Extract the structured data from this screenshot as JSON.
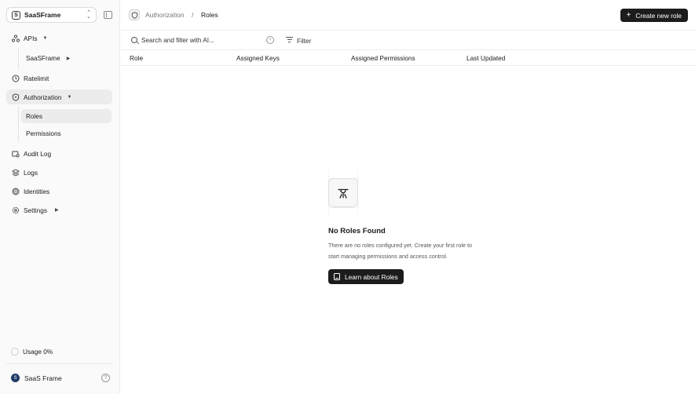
{
  "workspace": {
    "name": "SaaSFrame",
    "logo_letter": "S"
  },
  "sidebar": {
    "apis_label": "APIs",
    "apis_sub": "SaaSFrame",
    "ratelimit_label": "Ratelimit",
    "authorization_label": "Authorization",
    "roles_label": "Roles",
    "permissions_label": "Permissions",
    "audit_label": "Audit Log",
    "logs_label": "Logs",
    "identities_label": "Identities",
    "settings_label": "Settings",
    "usage_label": "Usage 0%",
    "user_name": "SaaS Frame",
    "user_initial": "S"
  },
  "header": {
    "breadcrumb_parent": "Authorization",
    "breadcrumb_sep": "/",
    "breadcrumb_current": "Roles",
    "create_label": "Create new role"
  },
  "filterbar": {
    "search_placeholder": "Search and filter with AI...",
    "filter_label": "Filter"
  },
  "table": {
    "columns": [
      "Role",
      "Assigned Keys",
      "Assigned Permissions",
      "Last Updated"
    ]
  },
  "empty_state": {
    "title": "No Roles Found",
    "line1": "There are no roles configured yet. Create your first role to",
    "line2": "start managing permissions and access control.",
    "button_label": "Learn about Roles"
  }
}
